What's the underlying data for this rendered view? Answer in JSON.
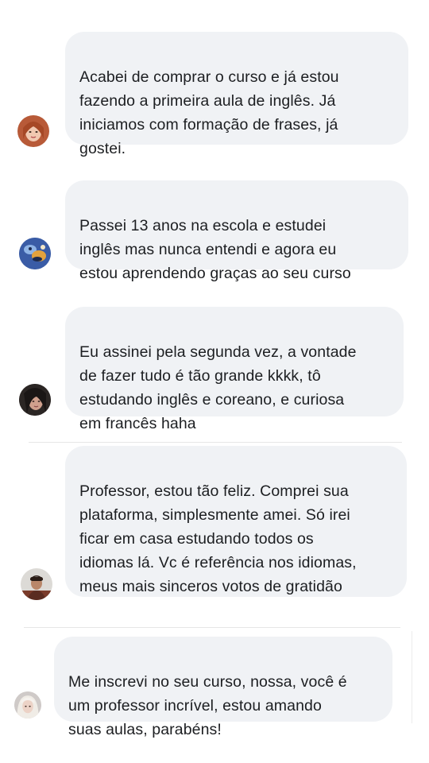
{
  "comments": [
    {
      "text": "Acabei de comprar o curso e já estou\nfazendo a primeira aula de inglês. Já\niniciamos com formação de frases, já\ngostei.",
      "avatar": "avatar-woman-red-hair-icon"
    },
    {
      "text": "Passei 13 anos na escola e estudei\ninglês mas nunca entendi e agora eu\nestou aprendendo graças ao seu curso",
      "avatar": "avatar-cartoon-icon"
    },
    {
      "text": "Eu assinei pela segunda vez, a vontade\nde fazer tudo é tão grande kkkk, tô\nestudando inglês e coreano, e curiosa\nem francês haha",
      "avatar": "avatar-woman-dark-hair-icon"
    },
    {
      "text": "Professor, estou tão feliz. Comprei sua\nplataforma, simplesmente amei. Só irei\nficar em casa estudando todos os\nidiomas lá. Vc é referência nos idiomas,\nmeus mais sinceros votos de gratidão",
      "emojis": [
        "heart-eyes-emoji-icon",
        "heart-eyes-emoji-icon"
      ],
      "avatar": "avatar-man-icon"
    },
    {
      "text": "Me inscrevi no seu curso, nossa, você é\num professor incrível, estou amando\nsuas aulas, parabéns!",
      "avatar": "avatar-woman-blonde-icon"
    }
  ],
  "colors": {
    "bubble": "#f0f2f5",
    "text": "#1c1e21",
    "divider": "#e6e6e6"
  }
}
